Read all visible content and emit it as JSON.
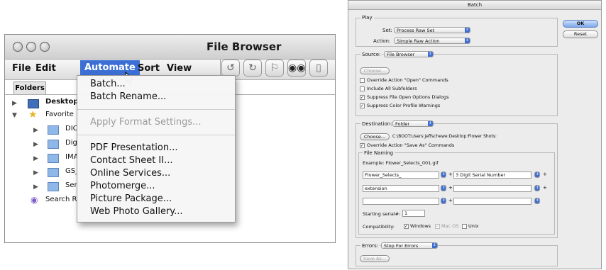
{
  "file_browser": {
    "title": "File Browser",
    "menus": [
      "File",
      "Edit",
      "Automate",
      "Sort",
      "View"
    ],
    "folders_tab": "Folders",
    "tree": [
      {
        "label": "Desktop",
        "icon": "desktop-icon",
        "expanded": false
      },
      {
        "label": "Favorite",
        "icon": "favorites-star-icon",
        "expanded": true
      },
      {
        "label": "DIC",
        "icon": "folder-icon"
      },
      {
        "label": "Dig",
        "icon": "folder-icon"
      },
      {
        "label": "IMA",
        "icon": "folder-icon"
      },
      {
        "label": "GS_",
        "icon": "folder-icon"
      },
      {
        "label": "Serv",
        "icon": "folder-icon"
      },
      {
        "label": "Search R",
        "icon": "search-results-icon"
      }
    ],
    "automate_menu": [
      {
        "label": "Batch...",
        "enabled": true
      },
      {
        "label": "Batch Rename...",
        "enabled": true
      },
      {
        "label": "Apply Format Settings...",
        "enabled": false
      },
      {
        "label": "PDF Presentation...",
        "enabled": true
      },
      {
        "label": "Contact Sheet II...",
        "enabled": true
      },
      {
        "label": "Online Services...",
        "enabled": true
      },
      {
        "label": "Photomerge...",
        "enabled": true
      },
      {
        "label": "Picture Package...",
        "enabled": true
      },
      {
        "label": "Web Photo Gallery...",
        "enabled": true
      }
    ],
    "toolbar_icons": [
      "rotate-ccw-icon",
      "rotate-cw-icon",
      "flag-icon",
      "binoculars-icon",
      "trash-icon"
    ]
  },
  "batch": {
    "title": "Batch",
    "ok": "OK",
    "reset": "Reset",
    "play": {
      "label": "Play",
      "set_label": "Set:",
      "set_value": "Process Raw Set",
      "action_label": "Action:",
      "action_value": "Simple Raw Action"
    },
    "source": {
      "label": "Source:",
      "value": "File Browser",
      "choose": "Choose...",
      "options": [
        {
          "label": "Override Action \"Open\" Commands",
          "checked": false
        },
        {
          "label": "Include All Subfolders",
          "checked": false
        },
        {
          "label": "Suppress File Open Options Dialogs",
          "checked": true
        },
        {
          "label": "Suppress Color Profile Warnings",
          "checked": true
        }
      ]
    },
    "destination": {
      "label": "Destination:",
      "value": "Folder",
      "choose": "Choose...",
      "path": "C:\\BOOT:Users:jeffschewe:Desktop:Flower Shots:",
      "override_label": "Override Action \"Save As\" Commands",
      "override_checked": true,
      "naming_label": "File Naming",
      "example": "Example: Flower_Selects_001.gif",
      "fields": [
        "Flower_Selects_",
        "3 Digit Serial Number",
        "extension",
        "",
        "",
        ""
      ],
      "serial_label": "Starting serial#:",
      "serial_value": "1",
      "compat_label": "Compatibility:",
      "compat": [
        {
          "label": "Windows",
          "checked": true
        },
        {
          "label": "Mac OS",
          "checked": true
        },
        {
          "label": "Unix",
          "checked": false
        }
      ]
    },
    "errors": {
      "label": "Errors:",
      "value": "Stop For Errors",
      "save_as": "Save As..."
    }
  }
}
